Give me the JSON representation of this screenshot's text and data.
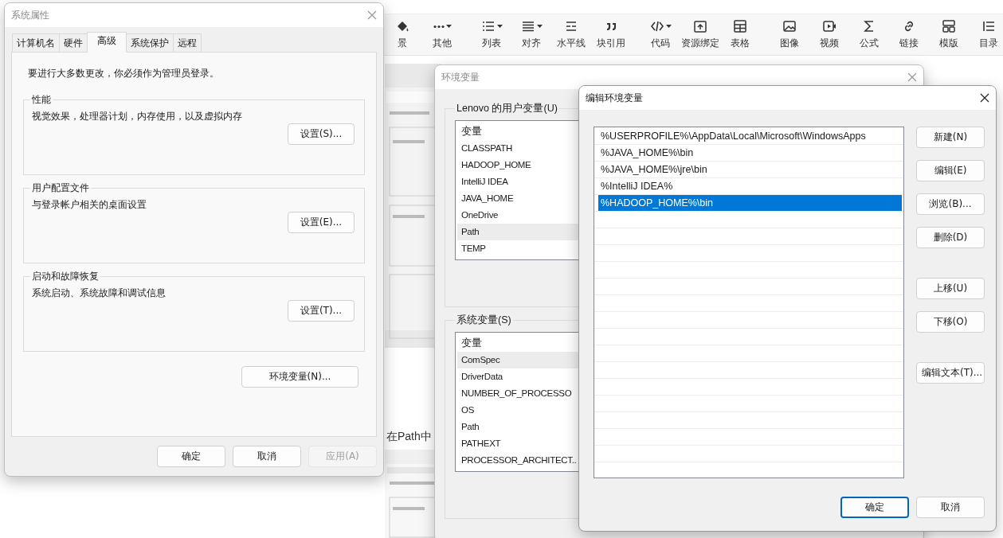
{
  "editor_toolbar": {
    "groups": [
      {
        "items": [
          {
            "label": "景",
            "dropdown": false
          },
          {
            "label": "其他",
            "dropdown": true
          }
        ]
      },
      {
        "items": [
          {
            "label": "列表",
            "dropdown": true
          },
          {
            "label": "对齐",
            "dropdown": true
          },
          {
            "label": "水平线",
            "dropdown": false
          },
          {
            "label": "块引用",
            "dropdown": false
          }
        ]
      },
      {
        "items": [
          {
            "label": "代码",
            "dropdown": true
          },
          {
            "label": "资源绑定",
            "dropdown": false
          },
          {
            "label": "表格",
            "dropdown": false
          }
        ]
      },
      {
        "items": [
          {
            "label": "图像",
            "dropdown": false
          },
          {
            "label": "视频",
            "dropdown": false
          },
          {
            "label": "公式",
            "dropdown": false
          },
          {
            "label": "链接",
            "dropdown": false
          },
          {
            "label": "模版",
            "dropdown": false
          },
          {
            "label": "目录",
            "dropdown": false
          }
        ]
      }
    ]
  },
  "document": {
    "heading": "在Path中"
  },
  "system_properties": {
    "title": "系统属性",
    "tabs": [
      {
        "label": "计算机名",
        "selected": false
      },
      {
        "label": "硬件",
        "selected": false
      },
      {
        "label": "高级",
        "selected": true
      },
      {
        "label": "系统保护",
        "selected": false
      },
      {
        "label": "远程",
        "selected": false
      }
    ],
    "notice": "要进行大多数更改，你必须作为管理员登录。",
    "groups": [
      {
        "title": "性能",
        "description": "视觉效果，处理器计划，内存使用，以及虚拟内存",
        "button": "设置(S)..."
      },
      {
        "title": "用户配置文件",
        "description": "与登录帐户相关的桌面设置",
        "button": "设置(E)..."
      },
      {
        "title": "启动和故障恢复",
        "description": "系统启动、系统故障和调试信息",
        "button": "设置(T)..."
      }
    ],
    "env_button": "环境变量(N)...",
    "buttons": [
      {
        "label": "确定",
        "disabled": false
      },
      {
        "label": "取消",
        "disabled": false
      },
      {
        "label": "应用(A)",
        "disabled": true
      }
    ]
  },
  "environment_variables": {
    "title": "环境变量",
    "groups": [
      {
        "title": "Lenovo 的用户变量(U)",
        "header": "变量",
        "rows": [
          {
            "name": "CLASSPATH",
            "highlighted": false
          },
          {
            "name": "HADOOP_HOME",
            "highlighted": false
          },
          {
            "name": "IntelliJ IDEA",
            "highlighted": false
          },
          {
            "name": "JAVA_HOME",
            "highlighted": false
          },
          {
            "name": "OneDrive",
            "highlighted": false
          },
          {
            "name": "Path",
            "highlighted": true
          },
          {
            "name": "TEMP",
            "highlighted": false
          }
        ]
      },
      {
        "title": "系统变量(S)",
        "header": "变量",
        "rows": [
          {
            "name": "ComSpec",
            "highlighted": true
          },
          {
            "name": "DriverData",
            "highlighted": false
          },
          {
            "name": "NUMBER_OF_PROCESSO",
            "highlighted": false
          },
          {
            "name": "OS",
            "highlighted": false
          },
          {
            "name": "Path",
            "highlighted": false
          },
          {
            "name": "PATHEXT",
            "highlighted": false
          },
          {
            "name": "PROCESSOR_ARCHITECT..",
            "highlighted": false
          }
        ]
      }
    ]
  },
  "edit_environment_variable": {
    "title": "编辑环境变量",
    "entries": [
      {
        "value": "%USERPROFILE%\\AppData\\Local\\Microsoft\\WindowsApps",
        "selected": false
      },
      {
        "value": "%JAVA_HOME%\\bin",
        "selected": false
      },
      {
        "value": "%JAVA_HOME%\\jre\\bin",
        "selected": false
      },
      {
        "value": "%IntelliJ IDEA%",
        "selected": false
      },
      {
        "value": "%HADOOP_HOME%\\bin",
        "selected": true
      }
    ],
    "side_button_groups": [
      [
        "新建(N)",
        "编辑(E)",
        "浏览(B)...",
        "删除(D)"
      ],
      [
        "上移(U)",
        "下移(O)"
      ],
      [
        "编辑文本(T)..."
      ]
    ],
    "buttons": [
      {
        "label": "确定",
        "default": true
      },
      {
        "label": "取消",
        "default": false
      }
    ]
  }
}
